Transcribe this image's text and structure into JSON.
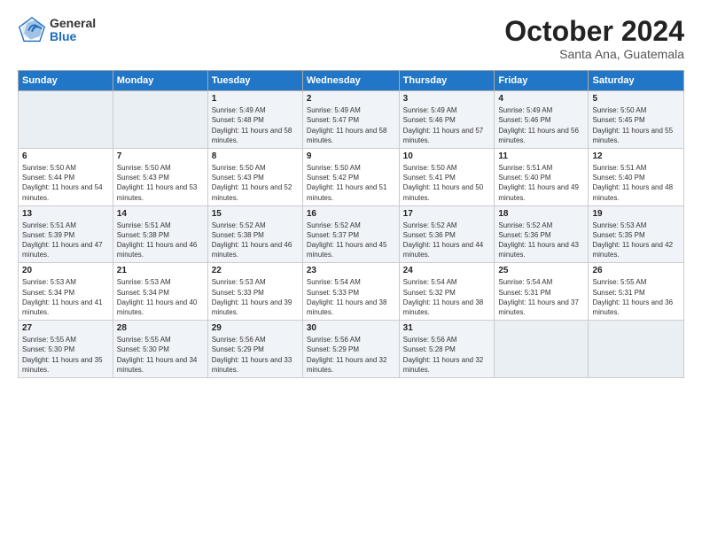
{
  "header": {
    "logo_general": "General",
    "logo_blue": "Blue",
    "month": "October 2024",
    "location": "Santa Ana, Guatemala"
  },
  "days_of_week": [
    "Sunday",
    "Monday",
    "Tuesday",
    "Wednesday",
    "Thursday",
    "Friday",
    "Saturday"
  ],
  "weeks": [
    [
      {
        "day": "",
        "info": ""
      },
      {
        "day": "",
        "info": ""
      },
      {
        "day": "1",
        "info": "Sunrise: 5:49 AM\nSunset: 5:48 PM\nDaylight: 11 hours and 58 minutes."
      },
      {
        "day": "2",
        "info": "Sunrise: 5:49 AM\nSunset: 5:47 PM\nDaylight: 11 hours and 58 minutes."
      },
      {
        "day": "3",
        "info": "Sunrise: 5:49 AM\nSunset: 5:46 PM\nDaylight: 11 hours and 57 minutes."
      },
      {
        "day": "4",
        "info": "Sunrise: 5:49 AM\nSunset: 5:46 PM\nDaylight: 11 hours and 56 minutes."
      },
      {
        "day": "5",
        "info": "Sunrise: 5:50 AM\nSunset: 5:45 PM\nDaylight: 11 hours and 55 minutes."
      }
    ],
    [
      {
        "day": "6",
        "info": "Sunrise: 5:50 AM\nSunset: 5:44 PM\nDaylight: 11 hours and 54 minutes."
      },
      {
        "day": "7",
        "info": "Sunrise: 5:50 AM\nSunset: 5:43 PM\nDaylight: 11 hours and 53 minutes."
      },
      {
        "day": "8",
        "info": "Sunrise: 5:50 AM\nSunset: 5:43 PM\nDaylight: 11 hours and 52 minutes."
      },
      {
        "day": "9",
        "info": "Sunrise: 5:50 AM\nSunset: 5:42 PM\nDaylight: 11 hours and 51 minutes."
      },
      {
        "day": "10",
        "info": "Sunrise: 5:50 AM\nSunset: 5:41 PM\nDaylight: 11 hours and 50 minutes."
      },
      {
        "day": "11",
        "info": "Sunrise: 5:51 AM\nSunset: 5:40 PM\nDaylight: 11 hours and 49 minutes."
      },
      {
        "day": "12",
        "info": "Sunrise: 5:51 AM\nSunset: 5:40 PM\nDaylight: 11 hours and 48 minutes."
      }
    ],
    [
      {
        "day": "13",
        "info": "Sunrise: 5:51 AM\nSunset: 5:39 PM\nDaylight: 11 hours and 47 minutes."
      },
      {
        "day": "14",
        "info": "Sunrise: 5:51 AM\nSunset: 5:38 PM\nDaylight: 11 hours and 46 minutes."
      },
      {
        "day": "15",
        "info": "Sunrise: 5:52 AM\nSunset: 5:38 PM\nDaylight: 11 hours and 46 minutes."
      },
      {
        "day": "16",
        "info": "Sunrise: 5:52 AM\nSunset: 5:37 PM\nDaylight: 11 hours and 45 minutes."
      },
      {
        "day": "17",
        "info": "Sunrise: 5:52 AM\nSunset: 5:36 PM\nDaylight: 11 hours and 44 minutes."
      },
      {
        "day": "18",
        "info": "Sunrise: 5:52 AM\nSunset: 5:36 PM\nDaylight: 11 hours and 43 minutes."
      },
      {
        "day": "19",
        "info": "Sunrise: 5:53 AM\nSunset: 5:35 PM\nDaylight: 11 hours and 42 minutes."
      }
    ],
    [
      {
        "day": "20",
        "info": "Sunrise: 5:53 AM\nSunset: 5:34 PM\nDaylight: 11 hours and 41 minutes."
      },
      {
        "day": "21",
        "info": "Sunrise: 5:53 AM\nSunset: 5:34 PM\nDaylight: 11 hours and 40 minutes."
      },
      {
        "day": "22",
        "info": "Sunrise: 5:53 AM\nSunset: 5:33 PM\nDaylight: 11 hours and 39 minutes."
      },
      {
        "day": "23",
        "info": "Sunrise: 5:54 AM\nSunset: 5:33 PM\nDaylight: 11 hours and 38 minutes."
      },
      {
        "day": "24",
        "info": "Sunrise: 5:54 AM\nSunset: 5:32 PM\nDaylight: 11 hours and 38 minutes."
      },
      {
        "day": "25",
        "info": "Sunrise: 5:54 AM\nSunset: 5:31 PM\nDaylight: 11 hours and 37 minutes."
      },
      {
        "day": "26",
        "info": "Sunrise: 5:55 AM\nSunset: 5:31 PM\nDaylight: 11 hours and 36 minutes."
      }
    ],
    [
      {
        "day": "27",
        "info": "Sunrise: 5:55 AM\nSunset: 5:30 PM\nDaylight: 11 hours and 35 minutes."
      },
      {
        "day": "28",
        "info": "Sunrise: 5:55 AM\nSunset: 5:30 PM\nDaylight: 11 hours and 34 minutes."
      },
      {
        "day": "29",
        "info": "Sunrise: 5:56 AM\nSunset: 5:29 PM\nDaylight: 11 hours and 33 minutes."
      },
      {
        "day": "30",
        "info": "Sunrise: 5:56 AM\nSunset: 5:29 PM\nDaylight: 11 hours and 32 minutes."
      },
      {
        "day": "31",
        "info": "Sunrise: 5:56 AM\nSunset: 5:28 PM\nDaylight: 11 hours and 32 minutes."
      },
      {
        "day": "",
        "info": ""
      },
      {
        "day": "",
        "info": ""
      }
    ]
  ]
}
